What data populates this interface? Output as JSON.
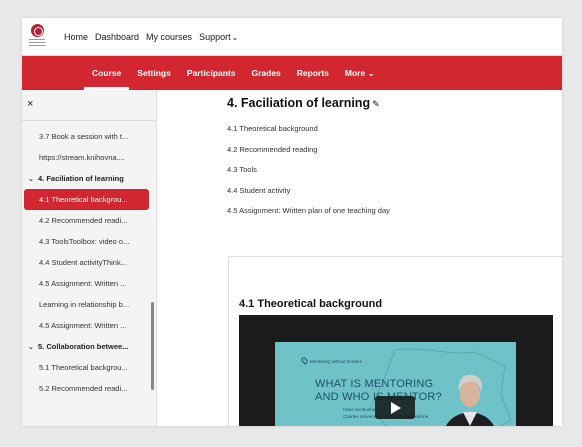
{
  "topnav": {
    "links": [
      "Home",
      "Dashboard",
      "My courses",
      "Support"
    ],
    "support_caret": "⌄"
  },
  "course_nav": {
    "tabs": [
      "Course",
      "Settings",
      "Participants",
      "Grades",
      "Reports",
      "More"
    ],
    "active": "Course",
    "more_caret": "⌄"
  },
  "sidebar": {
    "close_symbol": "×",
    "items": [
      {
        "label": "3.7 Book a session with t..."
      },
      {
        "label": "https://stream.knihovna...."
      },
      {
        "label": "4. Faciliation of learning",
        "section": true
      },
      {
        "label": "4.1 Theoretical backgrou...",
        "active": true
      },
      {
        "label": "4.2 Recommended readi..."
      },
      {
        "label": "4.3 ToolsToolbox: video o..."
      },
      {
        "label": "4.4 Student activityThink..."
      },
      {
        "label": "4.5 Assignment: Written ..."
      },
      {
        "label": "Learning in relationship b..."
      },
      {
        "label": "4.5 Assignment: Written ..."
      },
      {
        "label": "5. Collaboration betwee...",
        "section": true
      },
      {
        "label": "5.1 Theoretical backgrou..."
      },
      {
        "label": "5.2 Recommended readi..."
      }
    ]
  },
  "main": {
    "title": "4. Faciliation of learning",
    "edit_icon": "✎",
    "toc": [
      "4.1 Theoretical background",
      "4.2 Recommended reading",
      "4.3 Tools",
      "4.4 Student activity",
      "4.5 Assignment: Written plan of one teaching day"
    ],
    "section_title": "4.1 Theoretical background",
    "video": {
      "slide_small": "Mentoring without borders",
      "slide_line1": "WHAT IS MENTORING",
      "slide_line2": "AND WHO IS MENTOR?",
      "presenter": "Hana Svobodová",
      "affiliation": "Charles University, 3rd Faculty of Medicine"
    }
  },
  "colors": {
    "brand_red": "#d22630",
    "slide_teal": "#6fc3c8"
  }
}
